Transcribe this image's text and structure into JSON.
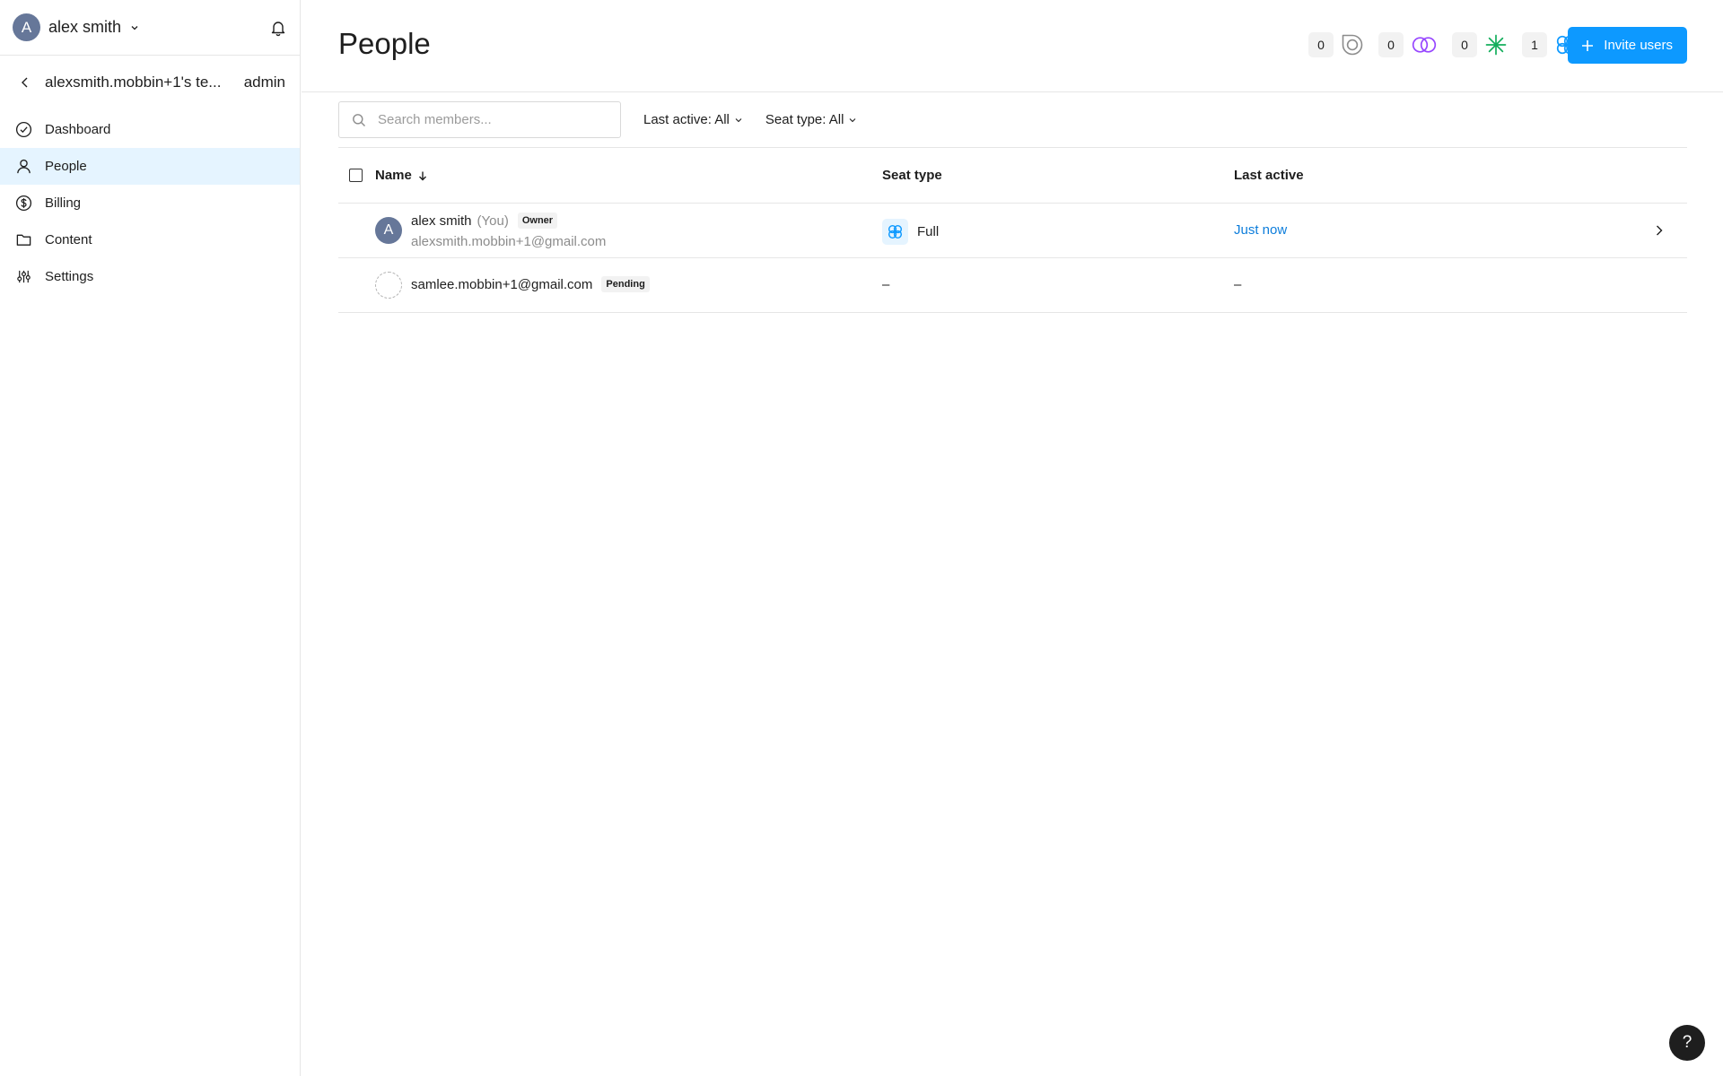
{
  "sidebar": {
    "user": {
      "initial": "A",
      "name": "alex smith"
    },
    "team": {
      "name": "alexsmith.mobbin+1's te...",
      "role": "admin"
    },
    "nav": [
      {
        "label": "Dashboard",
        "icon": "check-circle-icon"
      },
      {
        "label": "People",
        "icon": "person-icon",
        "active": true
      },
      {
        "label": "Billing",
        "icon": "dollar-circle-icon"
      },
      {
        "label": "Content",
        "icon": "folder-icon"
      },
      {
        "label": "Settings",
        "icon": "sliders-icon"
      }
    ]
  },
  "header": {
    "title": "People",
    "seat_counts": [
      {
        "count": "0",
        "icon": "viewer-seat-icon"
      },
      {
        "count": "0",
        "icon": "figjam-seat-icon"
      },
      {
        "count": "0",
        "icon": "dev-seat-icon"
      },
      {
        "count": "1",
        "icon": "full-seat-icon"
      }
    ],
    "invite_label": "Invite users"
  },
  "toolbar": {
    "search_placeholder": "Search members...",
    "filters": [
      {
        "label": "Last active: All"
      },
      {
        "label": "Seat type: All"
      }
    ]
  },
  "table": {
    "columns": {
      "name": "Name",
      "seat_type": "Seat type",
      "last_active": "Last active"
    },
    "rows": [
      {
        "initial": "A",
        "name": "alex smith",
        "you": "(You)",
        "tag": "Owner",
        "email": "alexsmith.mobbin+1@gmail.com",
        "seat_type": "Full",
        "last_active": "Just now"
      },
      {
        "name": "samlee.mobbin+1@gmail.com",
        "tag": "Pending",
        "seat_type": "–",
        "last_active": "–"
      }
    ]
  },
  "help": {
    "label": "?"
  },
  "colors": {
    "accent": "#0d99ff",
    "active_nav_bg": "#e5f4ff",
    "link": "#0d7ddb",
    "avatar": "#667799"
  }
}
